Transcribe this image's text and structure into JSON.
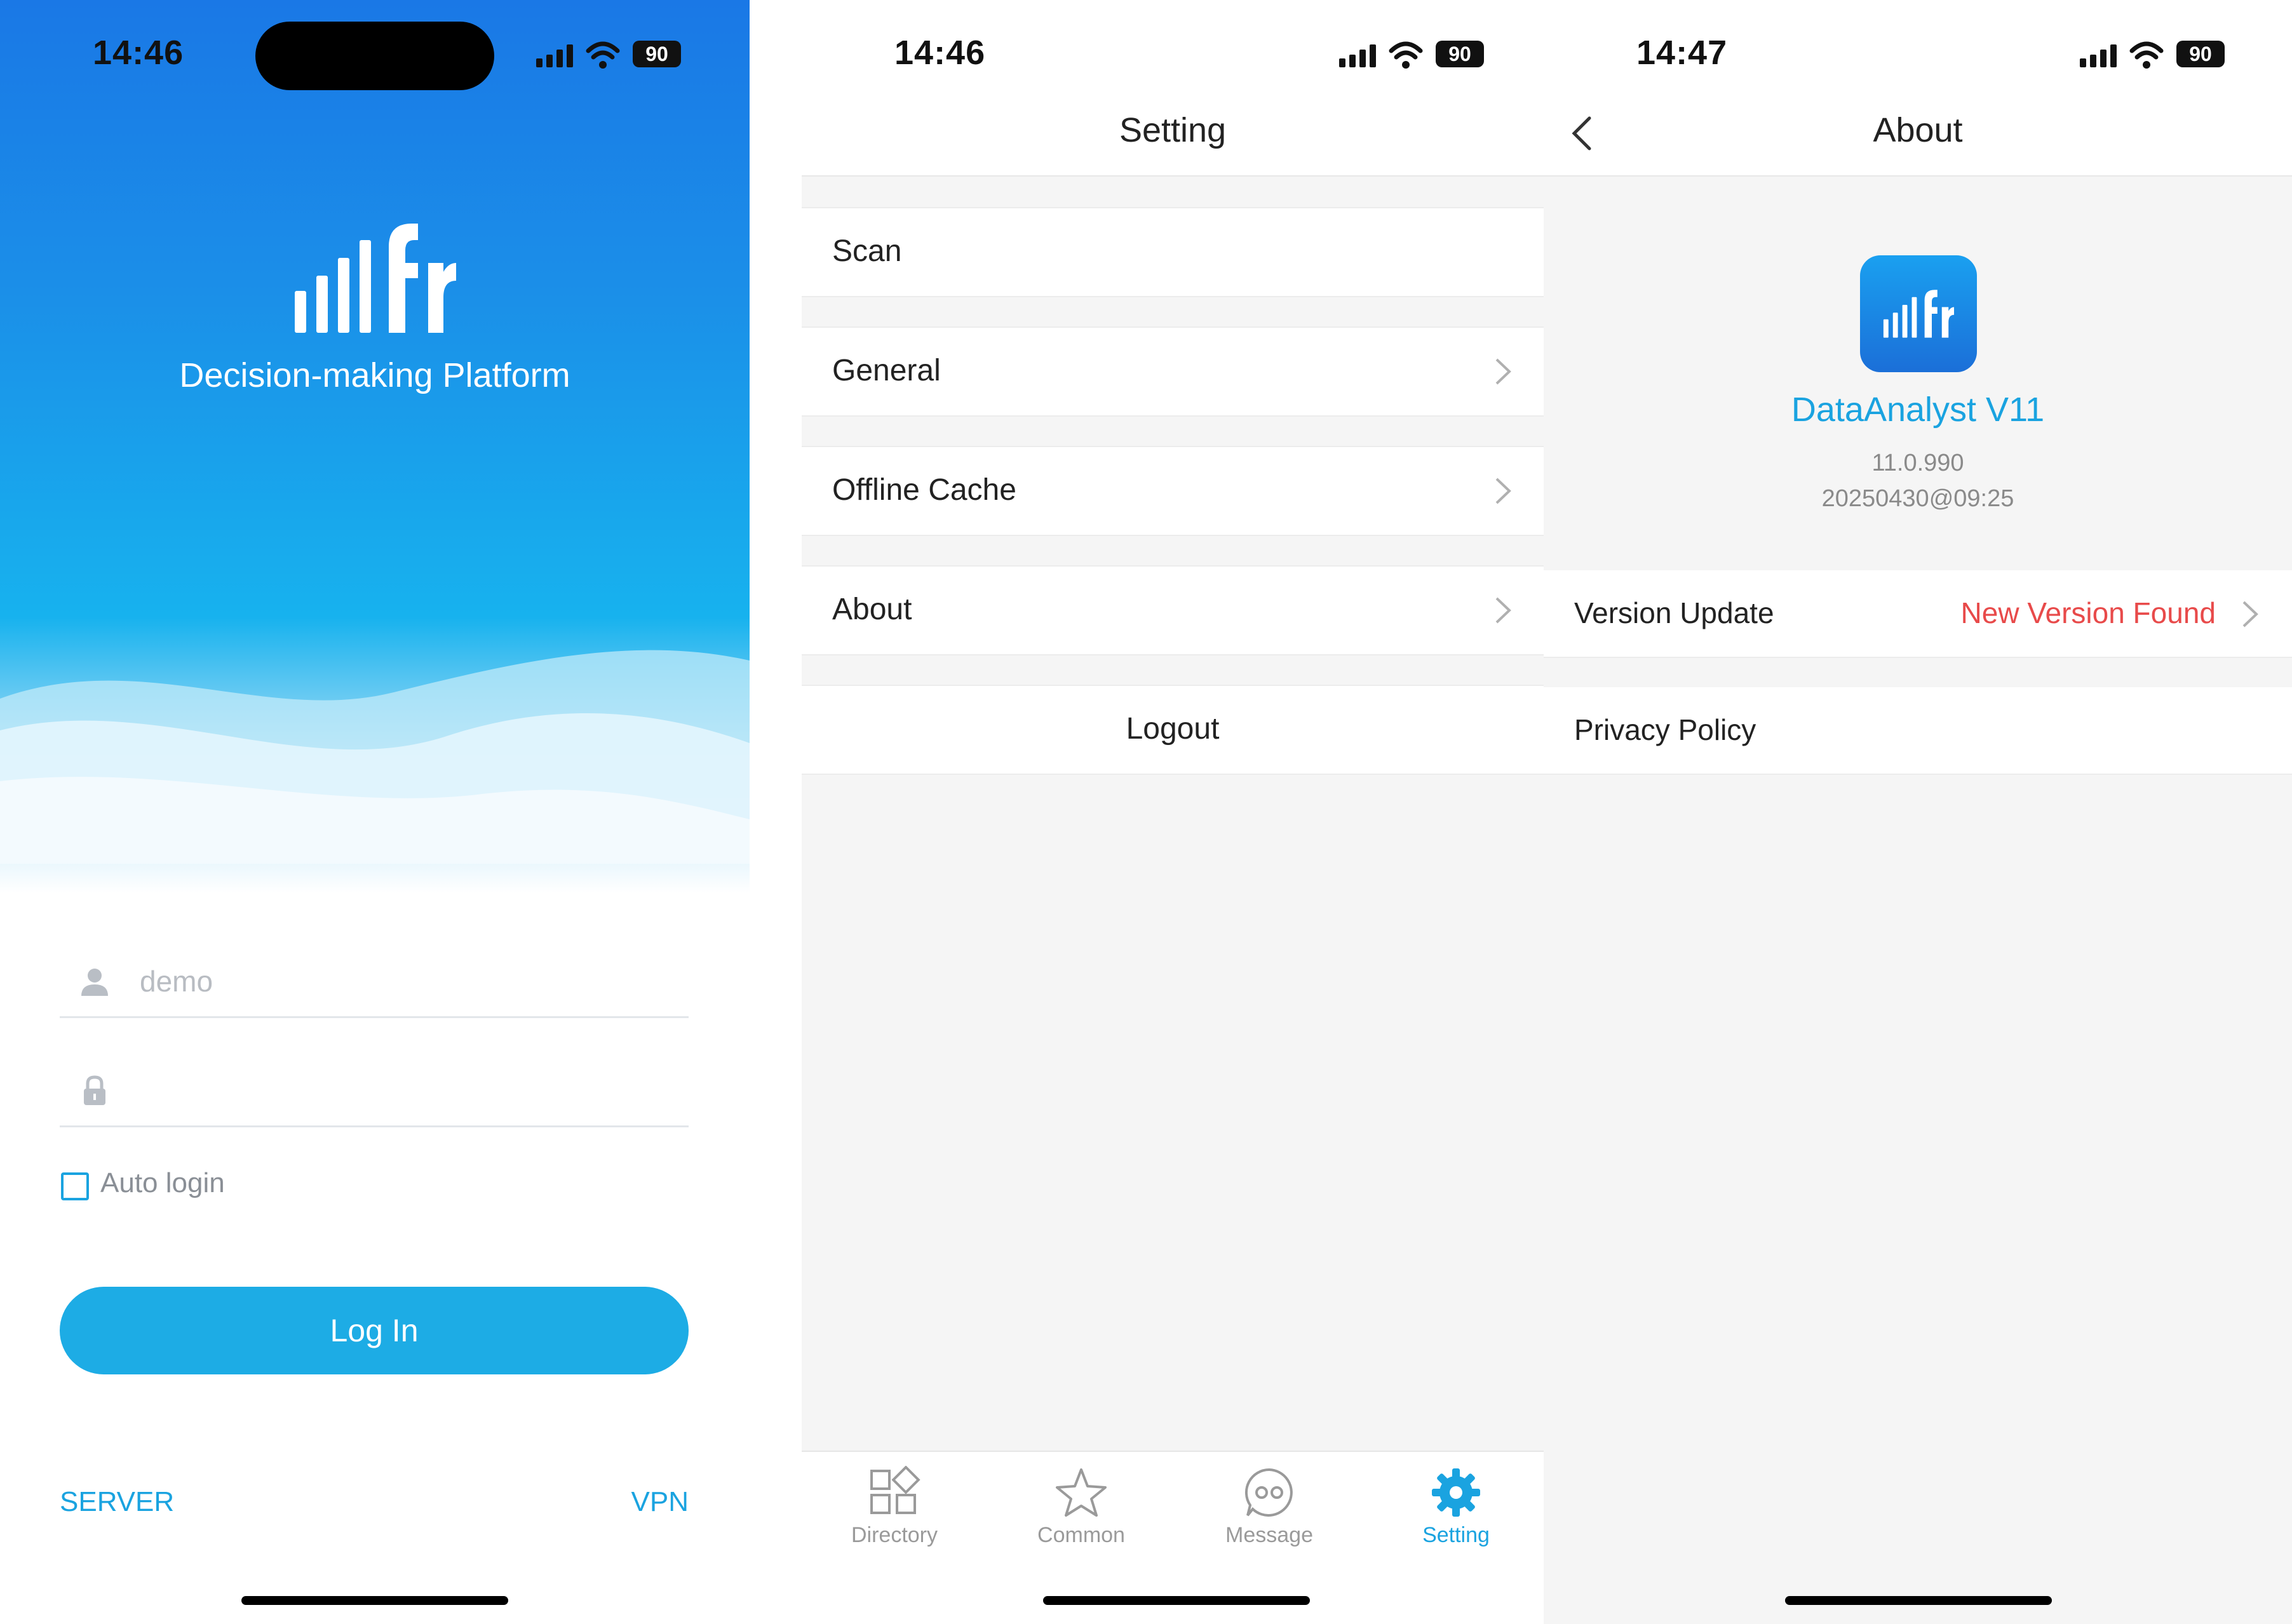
{
  "login": {
    "status_time": "14:46",
    "battery": "90",
    "tagline": "Decision-making Platform",
    "username_value": "demo",
    "password_value": "",
    "auto_login_label": "Auto login",
    "login_button": "Log In",
    "server_link": "SERVER",
    "vpn_link": "VPN"
  },
  "setting": {
    "status_time": "14:46",
    "battery": "90",
    "title": "Setting",
    "rows": [
      {
        "label": "Scan",
        "has_chevron": false
      },
      {
        "label": "General",
        "has_chevron": true
      },
      {
        "label": "Offline Cache",
        "has_chevron": true
      },
      {
        "label": "About",
        "has_chevron": true
      }
    ],
    "logout": "Logout",
    "tabs": [
      {
        "label": "Directory",
        "icon": "directory-icon",
        "active": false
      },
      {
        "label": "Common",
        "icon": "star-icon",
        "active": false
      },
      {
        "label": "Message",
        "icon": "message-icon",
        "active": false
      },
      {
        "label": "Setting",
        "icon": "gear-icon",
        "active": true
      }
    ]
  },
  "about": {
    "status_time": "14:47",
    "battery": "90",
    "title": "About",
    "app_name": "DataAnalyst V11",
    "version": "11.0.990",
    "build": "20250430@09:25",
    "version_update_label": "Version Update",
    "version_update_value": "New Version Found",
    "privacy_label": "Privacy Policy"
  },
  "colors": {
    "accent": "#1aa3e0",
    "alert": "#e84a4a",
    "brand_blue": "#1a78e6"
  }
}
